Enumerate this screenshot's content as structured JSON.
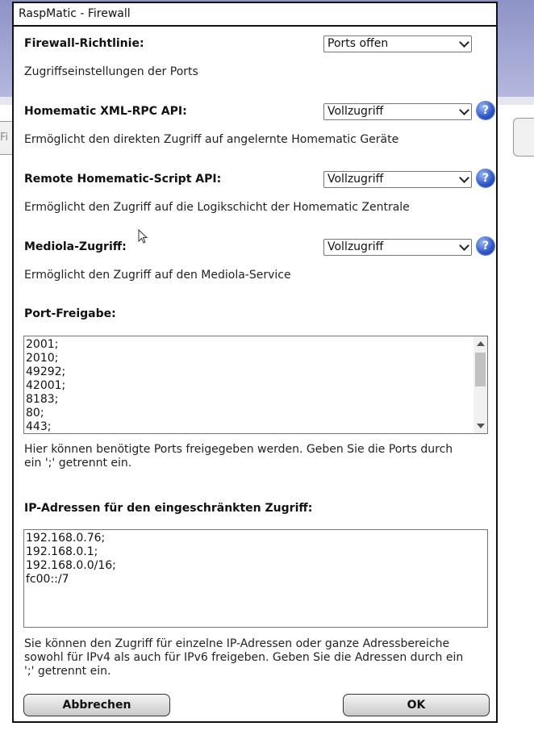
{
  "background": {
    "left_tab_text": "Fi"
  },
  "dialog": {
    "title": "RaspMatic - Firewall"
  },
  "firewall_policy": {
    "label": "Firewall-Richtlinie:",
    "value": "Ports offen",
    "description": "Zugriffseinstellungen der Ports"
  },
  "xmlrpc": {
    "label": "Homematic XML-RPC API:",
    "value": "Vollzugriff",
    "description": "Ermöglicht den direkten Zugriff auf angelernte Homematic Geräte",
    "help": "?"
  },
  "script_api": {
    "label": "Remote Homematic-Script API:",
    "value": "Vollzugriff",
    "description": "Ermöglicht den Zugriff auf die Logikschicht der Homematic Zentrale",
    "help": "?"
  },
  "mediola": {
    "label": "Mediola-Zugriff:",
    "value": "Vollzugriff",
    "description": "Ermöglicht den Zugriff auf den Mediola-Service",
    "help": "?"
  },
  "ports": {
    "label": "Port-Freigabe:",
    "lines": [
      "2001;",
      "2010;",
      "49292;",
      "42001;",
      "8183;",
      "80;",
      "443;"
    ],
    "description_1": "Hier können benötigte Ports freigegeben werden. Geben Sie die Ports durch",
    "description_2": "ein ';' getrennt ein."
  },
  "ip_access": {
    "label": "IP-Adressen für den eingeschränkten Zugriff:",
    "lines": [
      "192.168.0.76;",
      "192.168.0.1;",
      "192.168.0.0/16;",
      "fc00::/7"
    ],
    "description_1": "Sie können den Zugriff für einzelne IP-Adressen oder ganze Adressbereiche",
    "description_2": "sowohl für IPv4 als auch für IPv6 freigeben. Geben Sie die Adressen durch ein",
    "description_3": "';' getrennt ein."
  },
  "buttons": {
    "cancel": "Abbrechen",
    "ok": "OK"
  }
}
